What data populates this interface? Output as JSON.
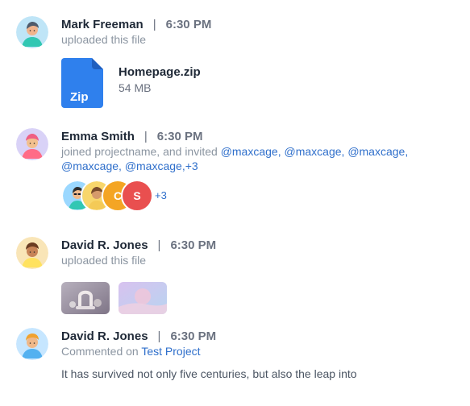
{
  "activity": [
    {
      "name": "Mark Freeman",
      "separator": "|",
      "time": "6:30 PM",
      "action": "uploaded this file",
      "file": {
        "icon": "zip-file-icon",
        "icon_label": "Zip",
        "name": "Homepage.zip",
        "size": "54 MB"
      },
      "avatar_icon": "avatar-mark-freeman"
    },
    {
      "name": "Emma Smith",
      "separator": "|",
      "time": "6:30 PM",
      "action_prefix": "joined projectname, and invited ",
      "mentions": [
        "@maxcage,",
        "@maxcage,",
        "@maxcage,",
        "@maxcage,",
        "@maxcage,+3"
      ],
      "avatar_stack": {
        "letters": [
          "C",
          "S"
        ],
        "more": "+3"
      },
      "avatar_icon": "avatar-emma-smith"
    },
    {
      "name": "David R. Jones",
      "separator": "|",
      "time": "6:30 PM",
      "action": "uploaded this file",
      "thumbnails": [
        "image-thumbnail-1",
        "image-thumbnail-2"
      ],
      "avatar_icon": "avatar-david-r-jones"
    },
    {
      "name": "David R. Jones",
      "separator": "|",
      "time": "6:30 PM",
      "action_prefix": "Commented on ",
      "project_link": "Test Project",
      "comment": "It has survived not only five centuries, but also the leap into",
      "avatar_icon": "avatar-david-r-jones-2"
    }
  ],
  "colors": {
    "link": "#2f6fcb",
    "zip_blue": "#2f80ed",
    "avatar_orange": "#f4a524",
    "avatar_red": "#e94f4f"
  }
}
